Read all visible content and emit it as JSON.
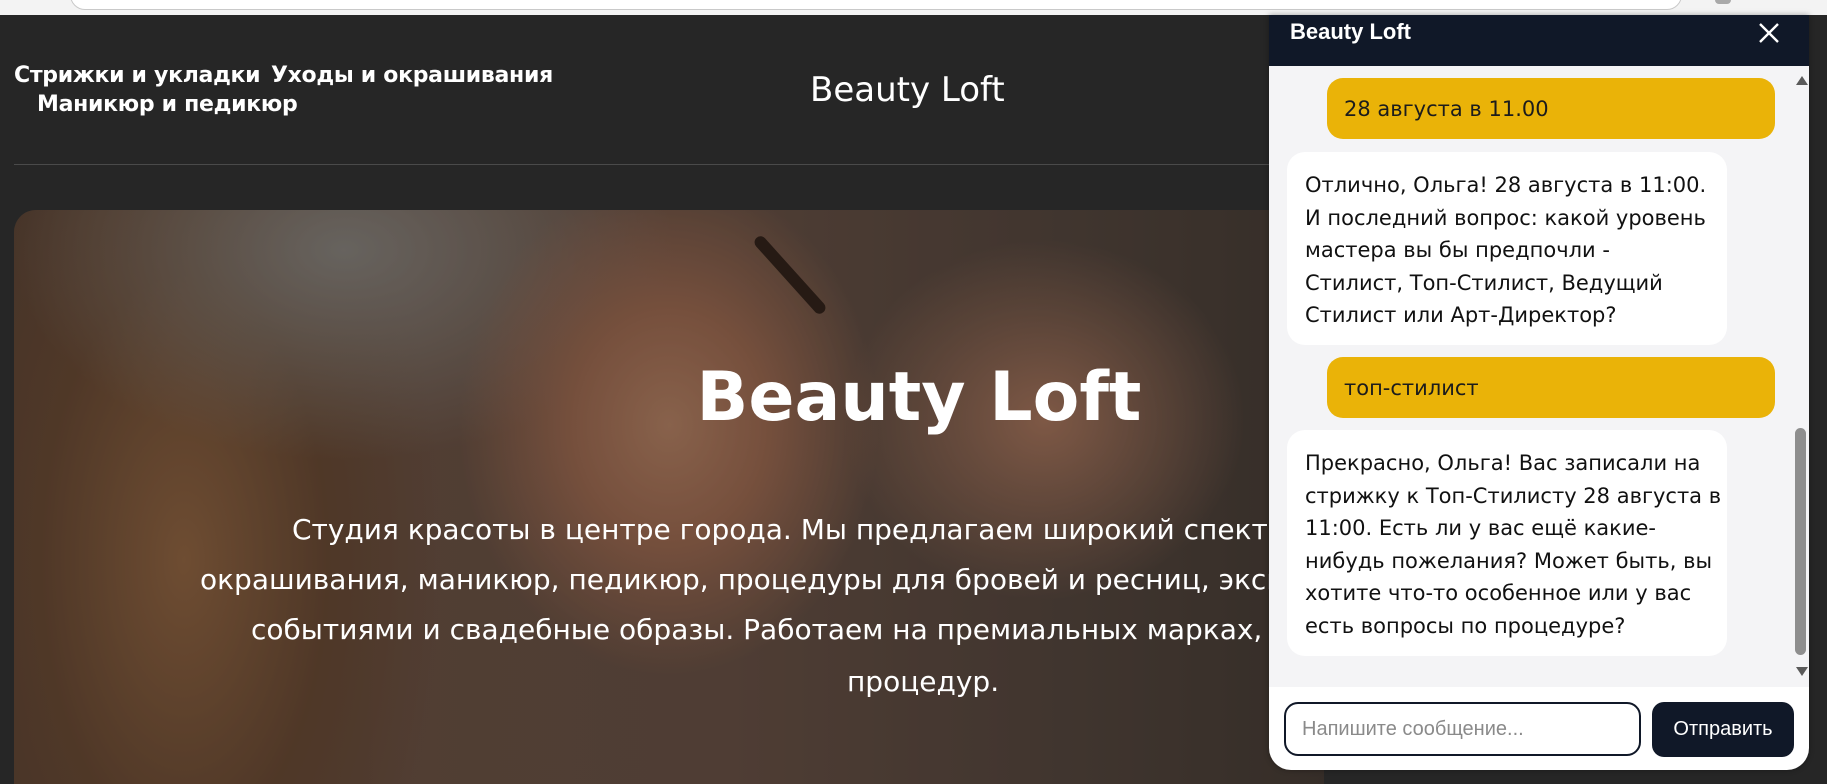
{
  "site": {
    "nav": [
      "Стрижки и укладки",
      "Уходы и окрашивания",
      "Маникюр и педикюр"
    ],
    "logo": "Beauty Loft"
  },
  "hero": {
    "title": "Beauty Loft",
    "text_lines": [
      "Студия красоты в центре города. Мы предлагаем широкий спектр услу",
      "окрашивания, маникюр, педикюр, процедуры для бровей и ресниц, экспресс-п",
      "событиями и свадебные образы. Работаем на премиальных марках, обесп",
      "процедур."
    ]
  },
  "chat": {
    "title": "Beauty Loft",
    "close_icon": "close-icon",
    "messages": [
      {
        "from": "user",
        "text": "28 августа в 11.00"
      },
      {
        "from": "bot",
        "lines": [
          "Отлично, Ольга! 28 августа в 11:00.",
          "И последний вопрос: какой уровень",
          "мастера вы бы предпочли -",
          "Стилист, Топ-Стилист, Ведущий",
          "Стилист или Арт-Директор?"
        ]
      },
      {
        "from": "user",
        "text": "топ-стилист"
      },
      {
        "from": "bot",
        "lines": [
          "Прекрасно, Ольга! Вас записали на",
          "стрижку к Топ-Стилисту 28 августа в",
          "11:00. Есть ли у вас ещё какие-",
          "нибудь пожелания? Может быть, вы",
          "хотите что-то особенное или у вас",
          "есть вопросы по процедуре?"
        ]
      }
    ],
    "input_placeholder": "Напишите сообщение...",
    "send_label": "Отправить"
  },
  "colors": {
    "chat_header": "#101828",
    "user_bubble": "#eab308",
    "page_bg": "#262626"
  }
}
